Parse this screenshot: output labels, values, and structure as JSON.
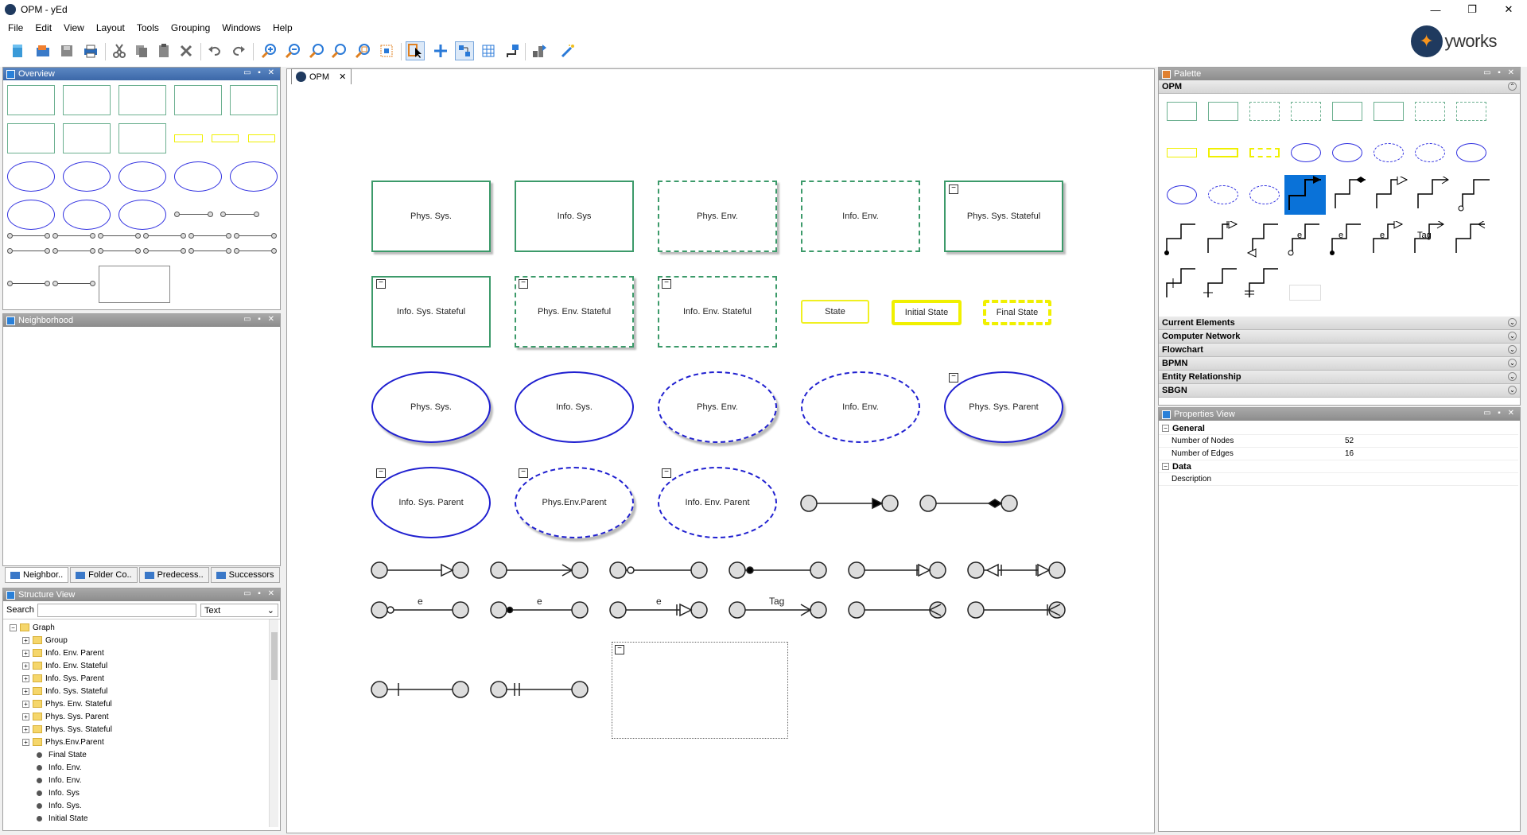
{
  "window": {
    "title": "OPM - yEd",
    "controls": [
      "—",
      "❐",
      "✕"
    ]
  },
  "menu": [
    "File",
    "Edit",
    "View",
    "Layout",
    "Tools",
    "Grouping",
    "Windows",
    "Help"
  ],
  "brand": {
    "logo_text": "yworks"
  },
  "panels": {
    "overview": "Overview",
    "neighborhood": "Neighborhood",
    "structure": "Structure View",
    "palette": "Palette",
    "properties": "Properties View"
  },
  "bottom_tabs": [
    "Neighbor..",
    "Folder Co..",
    "Predecess..",
    "Successors"
  ],
  "structure_view": {
    "search_label": "Search",
    "search_value": "",
    "filter_value": "Text",
    "root": "Graph",
    "groups": [
      "Group",
      "Info. Env. Parent",
      "Info. Env. Stateful",
      "Info. Sys. Parent",
      "Info. Sys. Stateful",
      "Phys. Env. Stateful",
      "Phys. Sys. Parent",
      "Phys. Sys. Stateful",
      "Phys.Env.Parent"
    ],
    "leaves": [
      "Final State",
      "Info. Env.",
      "Info. Env.",
      "Info. Sys",
      "Info. Sys.",
      "Initial State"
    ]
  },
  "document_tab": {
    "label": "OPM"
  },
  "diagram": {
    "row1": [
      "Phys. Sys.",
      "Info. Sys",
      "Phys. Env.",
      "Info. Env.",
      "Phys. Sys. Stateful"
    ],
    "row2": [
      "Info. Sys. Stateful",
      "Phys. Env. Stateful",
      "Info. Env. Stateful"
    ],
    "states": [
      "State",
      "Initial State",
      "Final State"
    ],
    "row3": [
      "Phys. Sys.",
      "Info. Sys.",
      "Phys. Env.",
      "Info. Env.",
      "Phys. Sys. Parent"
    ],
    "row4": [
      "Info. Sys. Parent",
      "Phys.Env.Parent",
      "Info. Env. Parent"
    ],
    "edge_labels": [
      "e",
      "e",
      "e",
      "Tag"
    ]
  },
  "palette": {
    "active_section": "OPM",
    "sections": [
      "Current Elements",
      "Computer Network",
      "Flowchart",
      "BPMN",
      "Entity Relationship",
      "SBGN"
    ],
    "item_texts": {
      "e1": "e",
      "e2": "e",
      "e3": "e",
      "tag": "Tag"
    }
  },
  "properties": {
    "general_label": "General",
    "rows": [
      {
        "key": "Number of Nodes",
        "value": "52"
      },
      {
        "key": "Number of Edges",
        "value": "16"
      }
    ],
    "data_label": "Data",
    "data_rows": [
      {
        "key": "Description",
        "value": ""
      }
    ]
  },
  "colors": {
    "accent": "#3c68a8",
    "opm_green": "#3c9a6a",
    "opm_blue": "#2020d0",
    "state_yellow": "#f0f000"
  },
  "icons": [
    "new-document-icon",
    "open-icon",
    "save-icon",
    "print-icon",
    "cut-icon",
    "copy-icon",
    "paste-icon",
    "delete-icon",
    "undo-icon",
    "redo-icon",
    "zoom-in-icon",
    "zoom-out-icon",
    "zoom-actual-icon",
    "zoom-fit-icon",
    "zoom-area-icon",
    "fit-content-icon",
    "edit-mode-icon",
    "move-icon",
    "snap-icon",
    "grid-icon",
    "orthogonal-edges-icon",
    "layout-icon",
    "magic-icon"
  ]
}
